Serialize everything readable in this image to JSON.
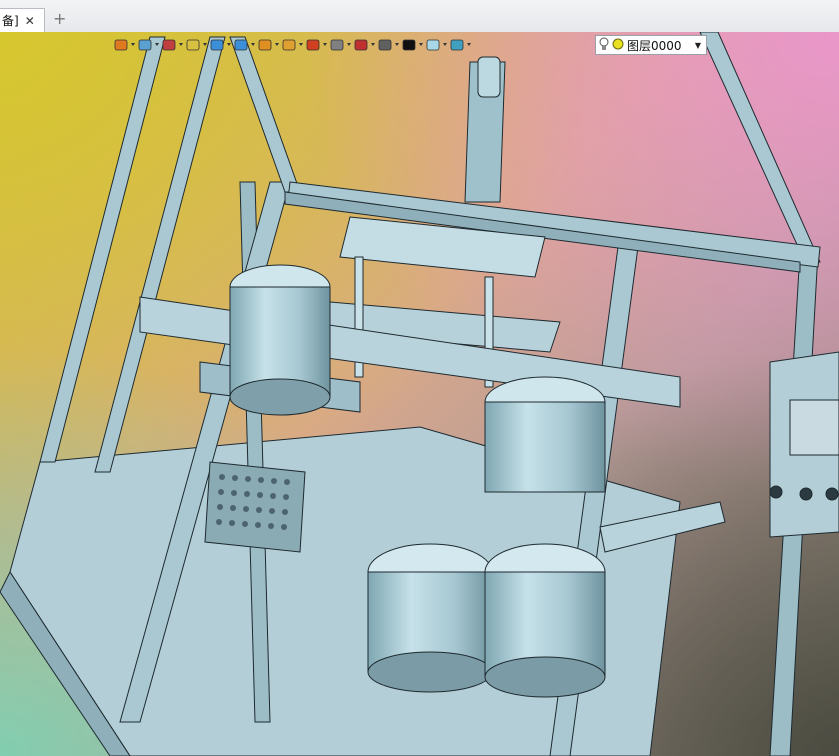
{
  "tab": {
    "label": "备]",
    "close": "✕",
    "add": "+"
  },
  "toolbar": {
    "buttons": [
      {
        "icon": "exit-view-icon",
        "color": "#e07a20"
      },
      {
        "icon": "print-icon",
        "color": "#5aa0d0"
      },
      {
        "icon": "pen-icon",
        "color": "#c04040"
      },
      {
        "icon": "layers-stack-icon",
        "color": "#d8c040"
      },
      {
        "icon": "cube-icon",
        "color": "#3b8fd8"
      },
      {
        "icon": "view-orient-icon",
        "color": "#3b8fd8"
      },
      {
        "icon": "render-pie-icon",
        "color": "#e09020"
      },
      {
        "icon": "section-view-icon",
        "color": "#e0a030"
      },
      {
        "icon": "target-icon",
        "color": "#d04020"
      },
      {
        "icon": "frame-icon",
        "color": "#808080"
      },
      {
        "icon": "bracket-icon",
        "color": "#c03030"
      },
      {
        "icon": "display-icon",
        "color": "#606060"
      },
      {
        "icon": "line-color-icon",
        "color": "#101010"
      },
      {
        "icon": "fill-color-icon",
        "color": "#a8d8e8"
      },
      {
        "icon": "layer-tools-icon",
        "color": "#40a0c0"
      }
    ],
    "layer_select": {
      "value": "图层0000",
      "bulb": "#f0d020",
      "dot": "#e8e020"
    }
  }
}
